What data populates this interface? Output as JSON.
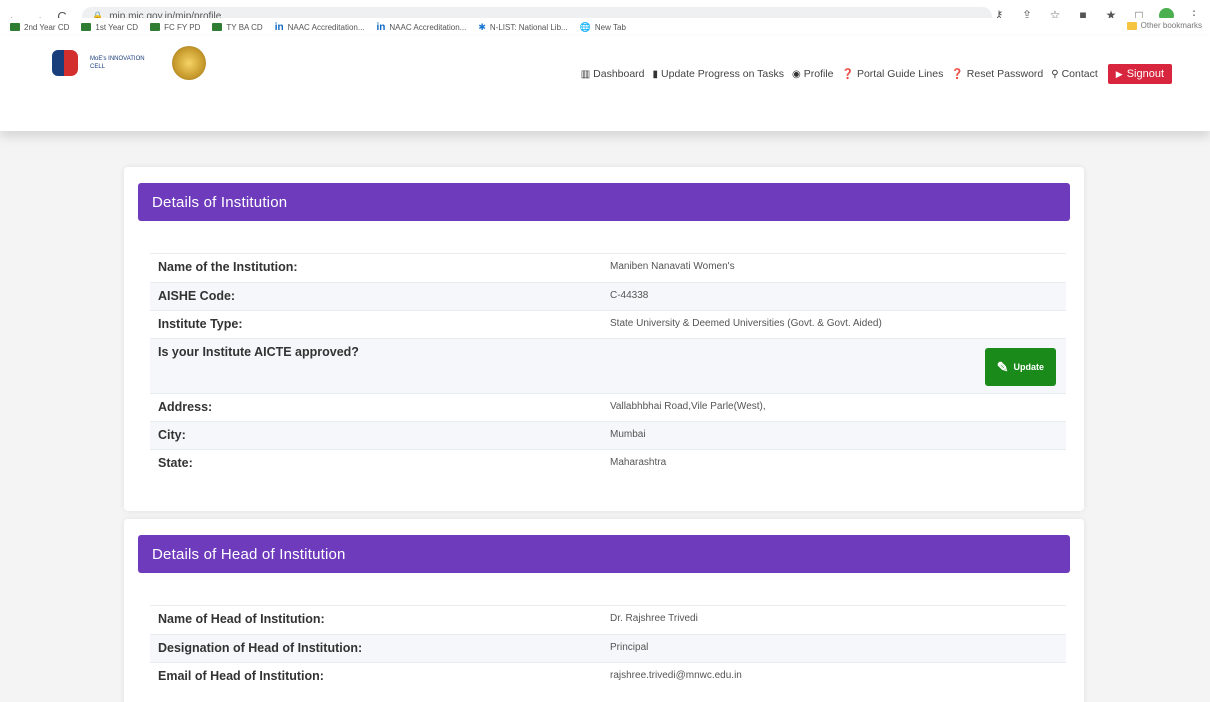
{
  "browser": {
    "url": "mip.mic.gov.in/mip/profile",
    "back_icon": "←",
    "forward_icon": "→",
    "reload_icon": "C"
  },
  "bookmarks": [
    {
      "label": "2nd Year CD",
      "icon": "doc"
    },
    {
      "label": "1st Year CD",
      "icon": "doc"
    },
    {
      "label": "FC FY PD",
      "icon": "doc"
    },
    {
      "label": "TY BA CD",
      "icon": "doc"
    },
    {
      "label": "NAAC Accreditation...",
      "icon": "linkedin"
    },
    {
      "label": "NAAC Accreditation...",
      "icon": "linkedin"
    },
    {
      "label": "N-LIST: National Lib...",
      "icon": "star"
    },
    {
      "label": "New Tab",
      "icon": "globe"
    }
  ],
  "bookmarks_right": "Other bookmarks",
  "site": {
    "logo_text": "MoE's INNOVATION CELL"
  },
  "nav": [
    {
      "label": "Dashboard",
      "icon": "▥"
    },
    {
      "label": "Update Progress on Tasks",
      "icon": "▮"
    },
    {
      "label": "Profile",
      "icon": "◉"
    },
    {
      "label": "Portal Guide Lines",
      "icon": "❓"
    },
    {
      "label": "Reset Password",
      "icon": "❓"
    },
    {
      "label": "Contact",
      "icon": "⚲"
    }
  ],
  "signout_label": "Signout",
  "institution": {
    "heading": "Details of Institution",
    "rows": [
      {
        "label": "Name of the Institution:",
        "value": "Maniben Nanavati Women's"
      },
      {
        "label": "AISHE Code:",
        "value": "C-44338"
      },
      {
        "label": "Institute Type:",
        "value": "State University & Deemed Universities (Govt. & Govt. Aided)"
      },
      {
        "label": "Is your Institute AICTE approved?",
        "value": ""
      },
      {
        "label": "Address:",
        "value": "Vallabhbhai Road,Vile Parle(West),"
      },
      {
        "label": "City:",
        "value": "Mumbai"
      },
      {
        "label": "State:",
        "value": "Maharashtra"
      }
    ],
    "update_label": "Update"
  },
  "head": {
    "heading": "Details of Head of Institution",
    "rows": [
      {
        "label": "Name of Head of Institution:",
        "value": "Dr. Rajshree Trivedi"
      },
      {
        "label": "Designation of Head of Institution:",
        "value": "Principal"
      },
      {
        "label": "Email of Head of Institution:",
        "value": "rajshree.trivedi@mnwc.edu.in"
      }
    ]
  }
}
